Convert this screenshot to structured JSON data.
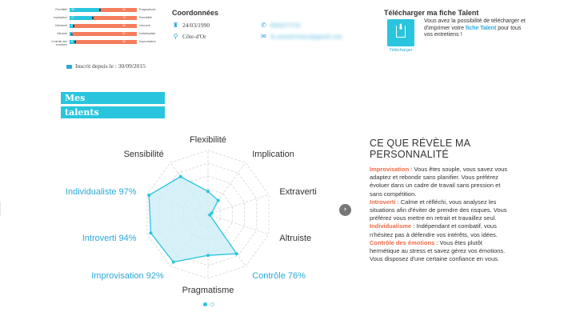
{
  "profile_bars": {
    "rows": [
      {
        "left": "Flexibilité",
        "right": "Pragmatisme",
        "fill": 0.45,
        "value_left": "36",
        "value_right": "64"
      },
      {
        "left": "Implication",
        "right": "Sensibilité",
        "fill": 0.34,
        "value_left": "27",
        "value_right": "73"
      },
      {
        "left": "Extraverti",
        "right": "Introverti",
        "fill": 0.06,
        "value_left": "6",
        "value_right": "94"
      },
      {
        "left": "Altruiste",
        "right": "Individualiste",
        "fill": 0.03,
        "value_left": "3",
        "value_right": "97"
      },
      {
        "left": "Contrôle des émotions",
        "right": "Improvisation",
        "fill": 0.08,
        "value_left": "8",
        "value_right": "92"
      }
    ]
  },
  "inscrit": "Inscrit depuis le : 30/09/2015",
  "coordonnees": {
    "title": "Coordonnées",
    "birthdate": "24/03/1990",
    "location": "Côte-d'Or",
    "phone": "0664275750",
    "email": "bc.arnault.france@gmail.com"
  },
  "download": {
    "title": "Télécharger ma fiche Talent",
    "caption": "Télécharger",
    "text_before": "Vous avez la possibilité de télécharger et d'imprimer votre ",
    "text_link": "fiche Talent",
    "text_after": " pour tous vos entretiens !"
  },
  "section_title": [
    "Mes",
    "talents"
  ],
  "chart_data": {
    "type": "radar",
    "axes": [
      "Flexibilité",
      "Implication",
      "Extraverti",
      "Altruiste",
      "Contrôle 76%",
      "Pragmatisme",
      "Improvisation 92%",
      "Introverti 94%",
      "Individualiste 97%",
      "Sensibilité"
    ],
    "highlighted_axes": [
      "Contrôle 76%",
      "Improvisation 92%",
      "Introverti 94%",
      "Individualiste 97%"
    ],
    "values": [
      36,
      27,
      6,
      3,
      76,
      64,
      92,
      94,
      97,
      73
    ],
    "range": [
      0,
      100
    ],
    "colors": {
      "line": "#29c5de",
      "fill": "#cdeef6",
      "grid": "#dcdcdc",
      "highlight_label": "#29a9d9",
      "label": "#333333"
    }
  },
  "personnalite": {
    "title": "CE QUE RÉVÈLE MA PERSONNALITÉ",
    "paragraphs": [
      {
        "term": "Improvisation",
        "text": " : Vous êtes souple, vous savez vous adaptez et rebondir sans planifier. Vous préférez évoluer dans un cadre de travail sans pression et sans compétition."
      },
      {
        "term": "Introverti",
        "text": " : Calme et réfléchi, vous analysez les situations afin d'éviter de prendre des risques. Vous préférez vous mettre en retrait et travaillez seul."
      },
      {
        "term": "Individualisme",
        "text": " : Indépendant et combatif, vous n'hésitez pas à défendre vos intérêts, vos idées."
      },
      {
        "term": "Contrôle des émotions",
        "text": " : Vous êtes plutôt hermétique au stress et savez gérez vos émotions. Vous disposez d'une certaine confiance en vous."
      }
    ]
  },
  "nav": {
    "next_glyph": "›"
  },
  "colors": {
    "accent": "#29c5de",
    "orange": "#f06a43",
    "bar_other": "#f47c5c"
  }
}
